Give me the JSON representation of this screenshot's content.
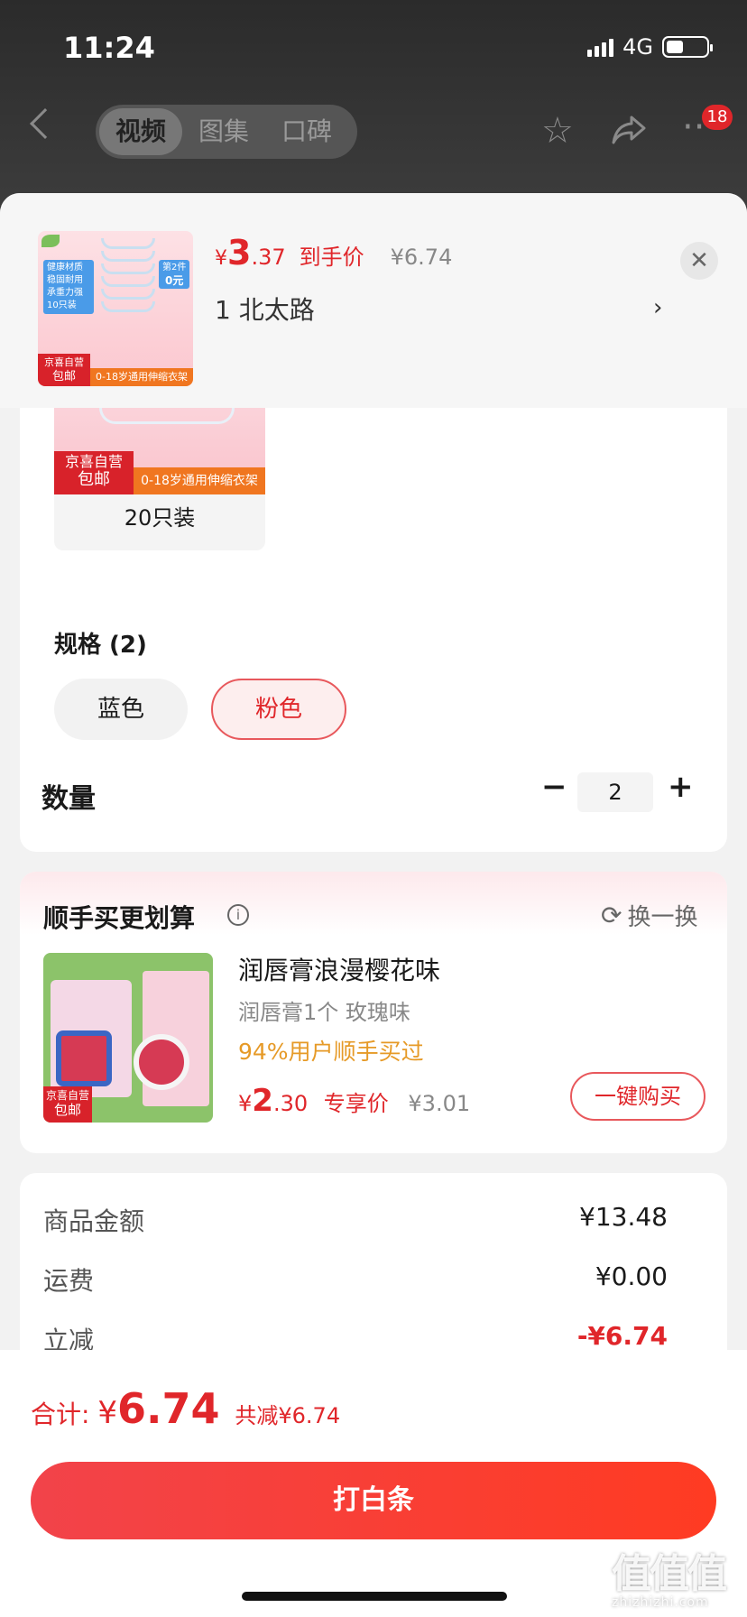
{
  "status": {
    "time": "11:24",
    "network": "4G"
  },
  "nav": {
    "tabs": [
      {
        "label": "视频",
        "active": true
      },
      {
        "label": "图集"
      },
      {
        "label": "口碑"
      }
    ],
    "badge_count": "18",
    "icons": [
      "back-arrow-icon",
      "star-icon",
      "share-icon",
      "more-icon"
    ]
  },
  "header": {
    "currency": "¥",
    "price_int": "3",
    "price_dec": ".37",
    "price_tag": "到手价",
    "original_price": "¥6.74",
    "selection_desc": "1  北太路",
    "thumb": {
      "tag1": "健康材质",
      "tag2": "稳固耐用",
      "tag3": "承重力强",
      "tag4": "10只装",
      "promo": "第2件",
      "promo2": "0元",
      "brand": "京喜自营",
      "free": "包邮",
      "banner": "0-18岁通用伸缩衣架"
    }
  },
  "variant": {
    "label": "20只装",
    "brand": "京喜自营",
    "free": "包邮",
    "banner": "0-18岁通用伸缩衣架"
  },
  "spec": {
    "title": "规格 (2)",
    "options": [
      {
        "label": "蓝色",
        "selected": false
      },
      {
        "label": "粉色",
        "selected": true
      }
    ]
  },
  "quantity": {
    "label": "数量",
    "value": "2",
    "minus": "−",
    "plus": "+"
  },
  "upsell": {
    "title": "顺手买更划算",
    "swap": "换一换",
    "name": "润唇膏浪漫樱花味",
    "sub": "润唇膏1个  玫瑰味",
    "rate": "94%用户顺手买过",
    "currency": "¥",
    "price_int": "2",
    "price_dec": ".30",
    "price_tag": "专享价",
    "original_price": "¥3.01",
    "buy_label": "一键购买",
    "brand": "京喜自营",
    "free": "包邮"
  },
  "summary": [
    {
      "label": "商品金额",
      "value": "¥13.48"
    },
    {
      "label": "运费",
      "value": "¥0.00"
    },
    {
      "label": "立减",
      "value": "-¥6.74"
    }
  ],
  "footer": {
    "total_label": "合计: ",
    "currency": "¥",
    "total_value": "6.74",
    "saved": "共减¥6.74",
    "pay_label": "打白条"
  },
  "watermark": {
    "text": "值值值",
    "url": "zhizhizhi.com"
  },
  "colors": {
    "accent": "#e0262a",
    "orange": "#e69a27",
    "pay_start": "#f2434a",
    "pay_end": "#ff3b22"
  }
}
